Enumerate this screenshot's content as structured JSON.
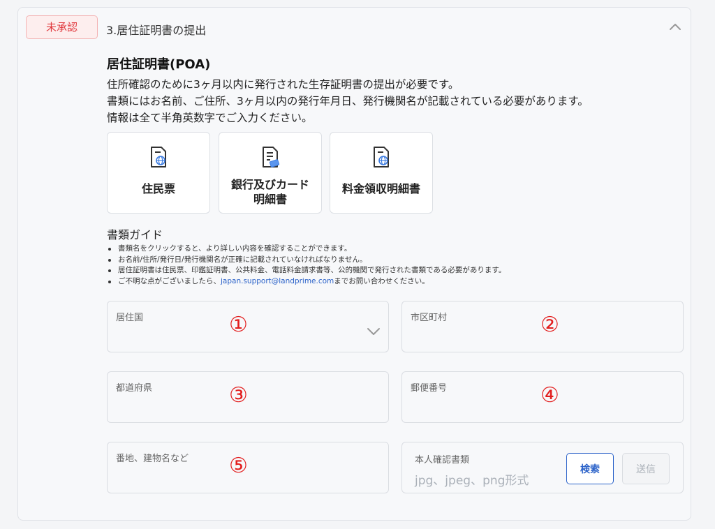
{
  "section": {
    "status_badge": "未承認",
    "title": "3.居住証明書の提出"
  },
  "poa": {
    "heading": "居住証明書(POA)",
    "desc_lines": [
      "住所確認のために3ヶ月以内に発行された生存証明書の提出が必要です。",
      "書類にはお名前、ご住所、3ヶ月以内の発行年月日、発行機関名が記載されている必要があります。",
      "情報は全て半角英数字でご入力ください。"
    ]
  },
  "doc_types": [
    {
      "label": "住民票",
      "icon": "document-globe-icon"
    },
    {
      "label_line1": "銀行及びカード",
      "label_line2": "明細書",
      "icon": "document-card-icon"
    },
    {
      "label": "料金領収明細書",
      "icon": "document-globe-icon"
    }
  ],
  "guide": {
    "title": "書類ガイド",
    "items": [
      "書類名をクリックすると、より詳しい内容を確認することができます。",
      "お名前/住所/発行日/発行機関名が正確に記載されていなければなりません。",
      "居住証明書は住民票、印鑑証明書、公共料金、電話料金請求書等、公的機関で発行された書類である必要があります。"
    ],
    "contact_prefix": "ご不明な点がございましたら、",
    "contact_email": "japan.support@landprime.com",
    "contact_suffix": "までお問い合わせください。"
  },
  "form": {
    "country_label": "居住国",
    "city_label": "市区町村",
    "prefecture_label": "都道府県",
    "postal_label": "郵便番号",
    "address_label": "番地、建物名など",
    "id_doc_label": "本人確認書類",
    "upload_placeholder": "jpg、jpeg、png形式",
    "search_button": "検索",
    "send_button": "送信"
  },
  "annotations": [
    "①",
    "②",
    "③",
    "④",
    "⑤"
  ],
  "colors": {
    "accent": "#2c63c9",
    "status_red": "#e0393e",
    "annotation_red": "#e21d1d"
  }
}
